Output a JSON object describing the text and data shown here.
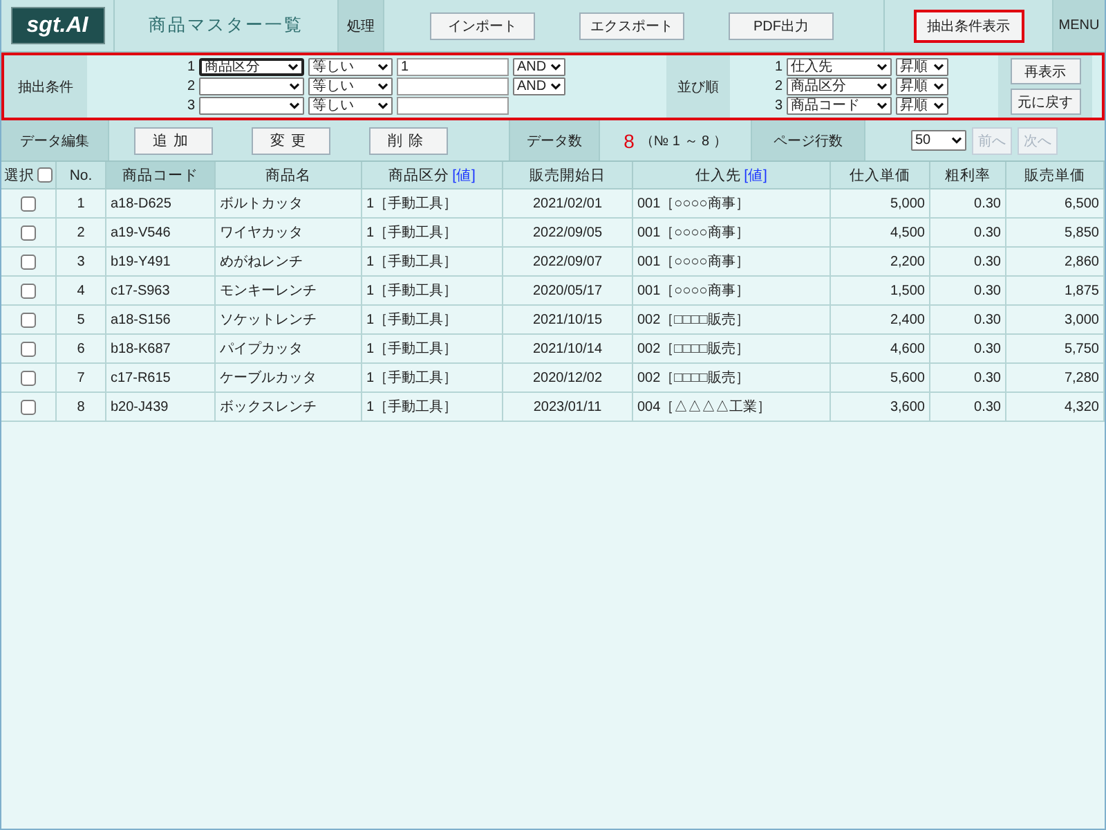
{
  "header": {
    "logo": "sgt.AI",
    "title": "商品マスター一覧",
    "process_label": "処理",
    "buttons": [
      "インポート",
      "エクスポート",
      "PDF出力"
    ],
    "filter_toggle": {
      "label": "抽出条件表示",
      "highlighted": true
    },
    "menu": "MENU"
  },
  "filter": {
    "highlighted": true,
    "label": "抽出条件",
    "conditions": [
      {
        "number": "1",
        "field": "商品区分",
        "focused": true,
        "operator": "等しい",
        "value": "1",
        "conjunction": "AND"
      },
      {
        "number": "2",
        "focused": false,
        "operator": "等しい",
        "conjunction": "AND"
      },
      {
        "number": "3",
        "focused": false,
        "operator": "等しい"
      }
    ],
    "sort_label": "並び順",
    "sort_keys": [
      {
        "number": "1",
        "field": "仕入先",
        "order": "昇順"
      },
      {
        "number": "2",
        "field": "商品区分",
        "order": "昇順"
      },
      {
        "number": "3",
        "field": "商品コード",
        "order": "昇順"
      }
    ],
    "buttons": [
      "再表示",
      "元に戻す"
    ]
  },
  "toolbar": {
    "edit_label": "データ編集",
    "edit_buttons": [
      "追加",
      "変更",
      "削除"
    ],
    "count_label": "データ数",
    "count": "8",
    "count_range": "（№ 1 ～ 8 ）",
    "page_size_label": "ページ行数",
    "page_size": "50",
    "pager": [
      {
        "label": "前へ",
        "disabled": true
      },
      {
        "label": "次へ",
        "disabled": true
      }
    ]
  },
  "table": {
    "select_column": {
      "label": "選択",
      "checked": false
    },
    "columns": [
      {
        "label": "No.",
        "highlighted": false
      },
      {
        "label": "商品コード",
        "highlighted": true
      },
      {
        "label": "商品名",
        "highlighted": false
      },
      {
        "label": "商品区分",
        "link": "[値]",
        "highlighted": false
      },
      {
        "label": "販売開始日",
        "highlighted": false
      },
      {
        "label": "仕入先",
        "link": "[値]",
        "highlighted": false
      },
      {
        "label": "仕入単価",
        "highlighted": false
      },
      {
        "label": "粗利率",
        "highlighted": false
      },
      {
        "label": "販売単価",
        "highlighted": false
      }
    ],
    "rows": [
      {
        "checked": false,
        "cells": [
          "1",
          "a18-D625",
          "ボルトカッタ",
          "1［手動工具］",
          "2021/02/01",
          "001［○○○○商事］",
          "5,000",
          "0.30",
          "6,500"
        ]
      },
      {
        "checked": false,
        "cells": [
          "2",
          "a19-V546",
          "ワイヤカッタ",
          "1［手動工具］",
          "2022/09/05",
          "001［○○○○商事］",
          "4,500",
          "0.30",
          "5,850"
        ]
      },
      {
        "checked": false,
        "cells": [
          "3",
          "b19-Y491",
          "めがねレンチ",
          "1［手動工具］",
          "2022/09/07",
          "001［○○○○商事］",
          "2,200",
          "0.30",
          "2,860"
        ]
      },
      {
        "checked": false,
        "cells": [
          "4",
          "c17-S963",
          "モンキーレンチ",
          "1［手動工具］",
          "2020/05/17",
          "001［○○○○商事］",
          "1,500",
          "0.30",
          "1,875"
        ]
      },
      {
        "checked": false,
        "cells": [
          "5",
          "a18-S156",
          "ソケットレンチ",
          "1［手動工具］",
          "2021/10/15",
          "002［□□□□販売］",
          "2,400",
          "0.30",
          "3,000"
        ]
      },
      {
        "checked": false,
        "cells": [
          "6",
          "b18-K687",
          "パイプカッタ",
          "1［手動工具］",
          "2021/10/14",
          "002［□□□□販売］",
          "4,600",
          "0.30",
          "5,750"
        ]
      },
      {
        "checked": false,
        "cells": [
          "7",
          "c17-R615",
          "ケーブルカッタ",
          "1［手動工具］",
          "2020/12/02",
          "002［□□□□販売］",
          "5,600",
          "0.30",
          "7,280"
        ]
      },
      {
        "checked": false,
        "cells": [
          "8",
          "b20-J439",
          "ボックスレンチ",
          "1［手動工具］",
          "2023/01/11",
          "004［△△△△工業］",
          "3,600",
          "0.30",
          "4,320"
        ]
      }
    ]
  }
}
